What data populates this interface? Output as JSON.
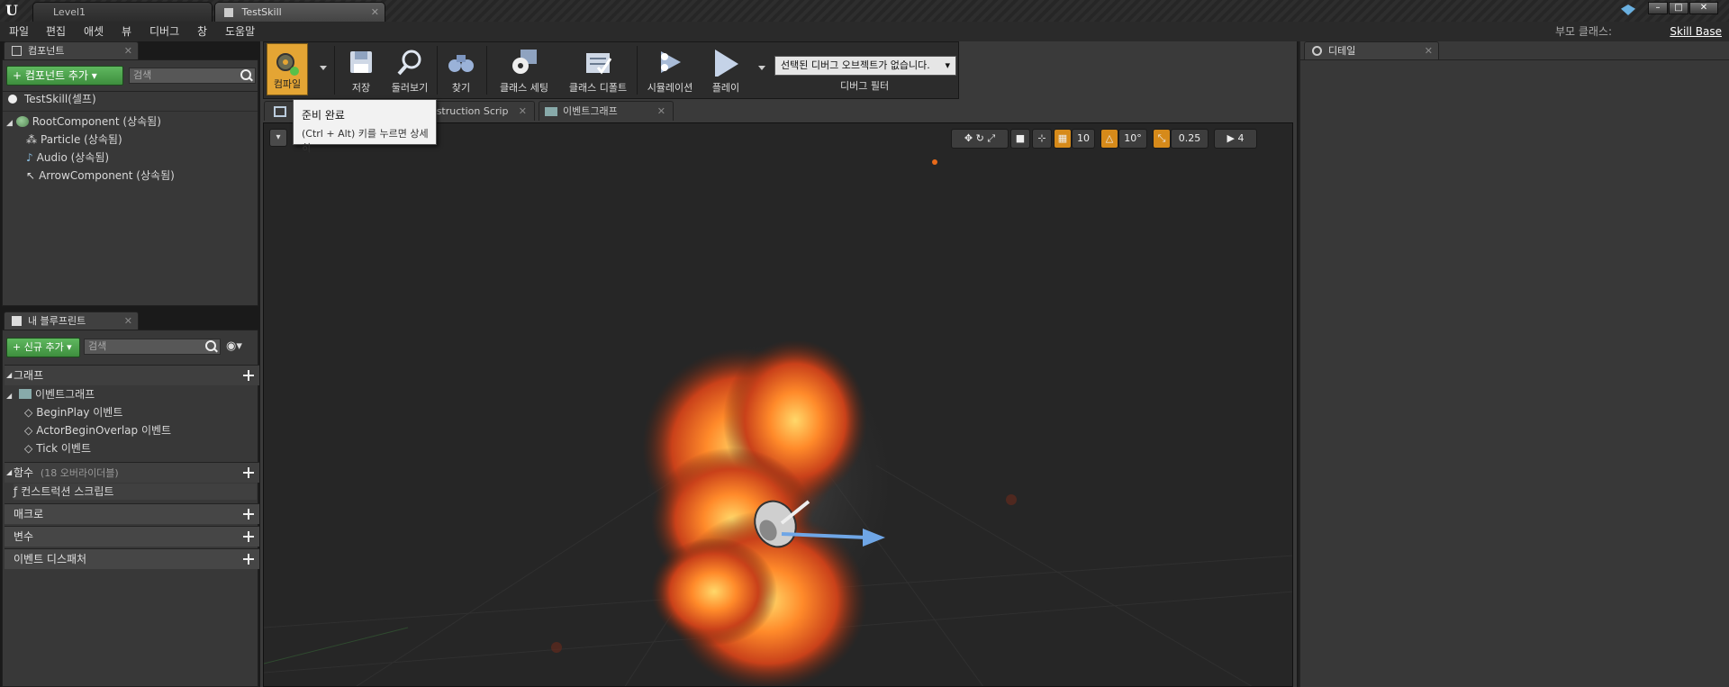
{
  "window_tabs": [
    {
      "label": "Level1"
    },
    {
      "label": "TestSkill"
    }
  ],
  "menus": [
    "파일",
    "편집",
    "애셋",
    "뷰",
    "디버그",
    "창",
    "도움말"
  ],
  "parent_class": {
    "label": "부모 클래스:",
    "value": "Skill Base"
  },
  "components_panel": {
    "tab": "컴포넌트",
    "add_button": "+ 컴포넌트 추가 ▾",
    "search_placeholder": "검색",
    "items": [
      {
        "label": "TestSkill(셀프)"
      },
      {
        "label": "RootComponent (상속됨)"
      },
      {
        "label": "Particle (상속됨)"
      },
      {
        "label": "Audio (상속됨)"
      },
      {
        "label": "ArrowComponent (상속됨)"
      }
    ]
  },
  "my_blueprint": {
    "tab": "내 블루프린트",
    "add_button": "+ 신규 추가 ▾",
    "search_placeholder": "검색",
    "graph_section": "그래프",
    "event_graph": "이벤트그래프",
    "events": [
      {
        "label": "BeginPlay 이벤트"
      },
      {
        "label": "ActorBeginOverlap 이벤트"
      },
      {
        "label": "Tick 이벤트"
      }
    ],
    "functions_section": "함수",
    "functions_note": "(18 오버라이더블)",
    "construction_script": "컨스트럭션 스크립트",
    "macros": "매크로",
    "variables": "변수",
    "dispatchers": "이벤트 디스패처"
  },
  "toolbar": {
    "buttons": [
      {
        "label": "컴파일"
      },
      {
        "label": "저장"
      },
      {
        "label": "둘러보기"
      },
      {
        "label": "찾기"
      },
      {
        "label": "클래스 세팅"
      },
      {
        "label": "클래스 디폴트"
      },
      {
        "label": "시뮬레이션"
      },
      {
        "label": "플레이"
      }
    ],
    "debug_combo": "선택된 디버그 오브젝트가 없습니다.",
    "debug_filter": "디버그 필터"
  },
  "graph_tabs": [
    {
      "label": "onstruction Scrip"
    },
    {
      "label": "이벤트그래프"
    }
  ],
  "tooltip": {
    "title": "준비 완료",
    "hint": "(Ctrl + Alt) 키를 누르면 상세히"
  },
  "viewport_controls": {
    "grid": "10",
    "rotation": "10°",
    "scale": "0.25",
    "speed": "4"
  },
  "details_panel": {
    "tab": "디테일"
  },
  "colors": {
    "accent_orange": "#d68a1a",
    "green_button": "#4aa34a",
    "panel_bg": "#383838"
  }
}
